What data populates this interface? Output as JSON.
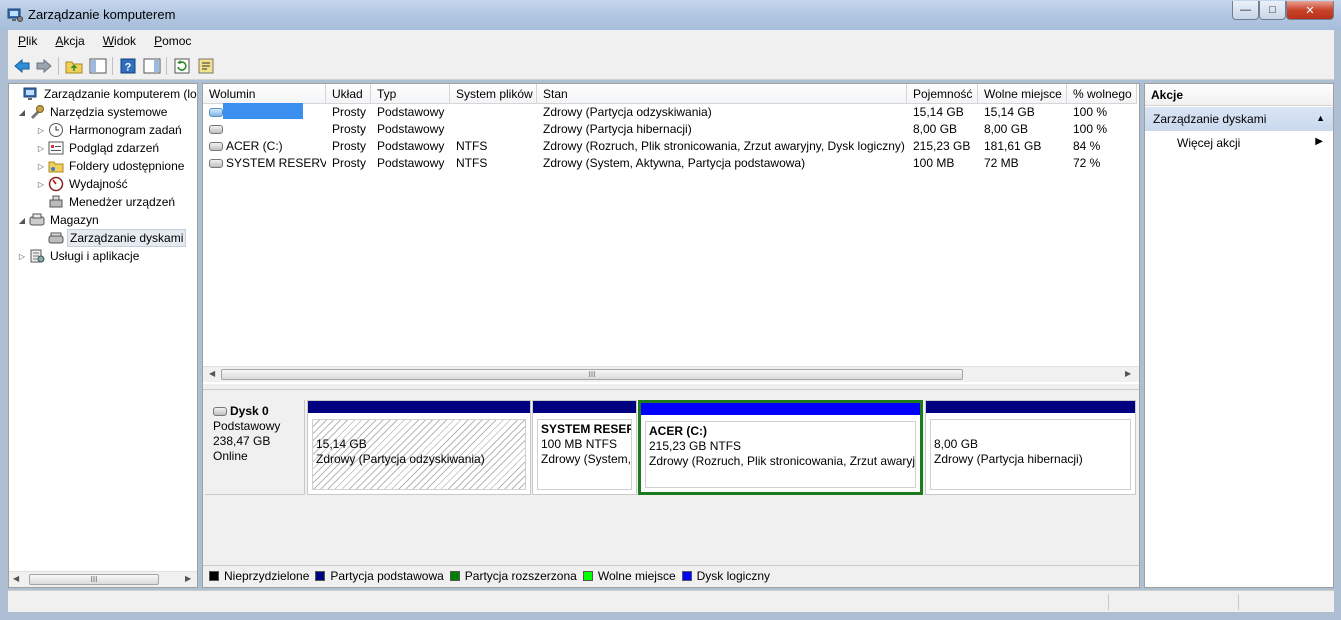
{
  "window": {
    "title": "Zarządzanie komputerem",
    "minimize": "—",
    "maximize": "□",
    "close": "✕"
  },
  "menu": [
    "Plik",
    "Akcja",
    "Widok",
    "Pomoc"
  ],
  "tree": {
    "root": "Zarządzanie komputerem (loka",
    "system_tools": "Narzędzia systemowe",
    "task_scheduler": "Harmonogram zadań",
    "event_viewer": "Podgląd zdarzeń",
    "shared_folders": "Foldery udostępnione",
    "performance": "Wydajność",
    "device_manager": "Menedżer urządzeń",
    "storage": "Magazyn",
    "disk_management": "Zarządzanie dyskami",
    "services": "Usługi i aplikacje"
  },
  "volumes": {
    "columns": [
      "Wolumin",
      "Układ",
      "Typ",
      "System plików",
      "Stan",
      "Pojemność",
      "Wolne miejsce",
      "% wolnego"
    ],
    "rows": [
      {
        "name": "",
        "layout": "Prosty",
        "type": "Podstawowy",
        "fs": "",
        "status": "Zdrowy (Partycja odzyskiwania)",
        "capacity": "15,14 GB",
        "free": "15,14 GB",
        "pct": "100 %"
      },
      {
        "name": "",
        "layout": "Prosty",
        "type": "Podstawowy",
        "fs": "",
        "status": "Zdrowy (Partycja hibernacji)",
        "capacity": "8,00 GB",
        "free": "8,00 GB",
        "pct": "100 %"
      },
      {
        "name": "ACER (C:)",
        "layout": "Prosty",
        "type": "Podstawowy",
        "fs": "NTFS",
        "status": "Zdrowy (Rozruch, Plik stronicowania, Zrzut awaryjny, Dysk logiczny)",
        "capacity": "215,23 GB",
        "free": "181,61 GB",
        "pct": "84 %"
      },
      {
        "name": "SYSTEM RESERVED",
        "layout": "Prosty",
        "type": "Podstawowy",
        "fs": "NTFS",
        "status": "Zdrowy (System, Aktywna, Partycja podstawowa)",
        "capacity": "100 MB",
        "free": "72 MB",
        "pct": "72 %"
      }
    ]
  },
  "disk": {
    "name": "Dysk 0",
    "type": "Podstawowy",
    "size": "238,47 GB",
    "state": "Online",
    "partitions": [
      {
        "title": "",
        "size": "15,14 GB",
        "status": "Zdrowy (Partycja odzyskiwania)",
        "color": "#000080"
      },
      {
        "title": "SYSTEM RESERV",
        "size": "100 MB NTFS",
        "status": "Zdrowy (System,",
        "color": "#000080"
      },
      {
        "title": "ACER  (C:)",
        "size": "215,23 GB NTFS",
        "status": "Zdrowy (Rozruch, Plik stronicowania, Zrzut awaryj",
        "color": "#0000ff"
      },
      {
        "title": "",
        "size": "8,00 GB",
        "status": "Zdrowy (Partycja hibernacji)",
        "color": "#000080"
      }
    ]
  },
  "legend": [
    {
      "label": "Nieprzydzielone",
      "color": "#000000"
    },
    {
      "label": "Partycja podstawowa",
      "color": "#000080"
    },
    {
      "label": "Partycja rozszerzona",
      "color": "#008000"
    },
    {
      "label": "Wolne miejsce",
      "color": "#00ff00"
    },
    {
      "label": "Dysk logiczny",
      "color": "#0000ff"
    }
  ],
  "actions": {
    "title": "Akcje",
    "group": "Zarządzanie dyskami",
    "more": "Więcej akcji"
  },
  "scroll": {
    "grip": "III"
  },
  "colors": {
    "selection": "#1c7a1c",
    "redacted": "#3c8fef",
    "actions_header": "#c8d8ee"
  }
}
